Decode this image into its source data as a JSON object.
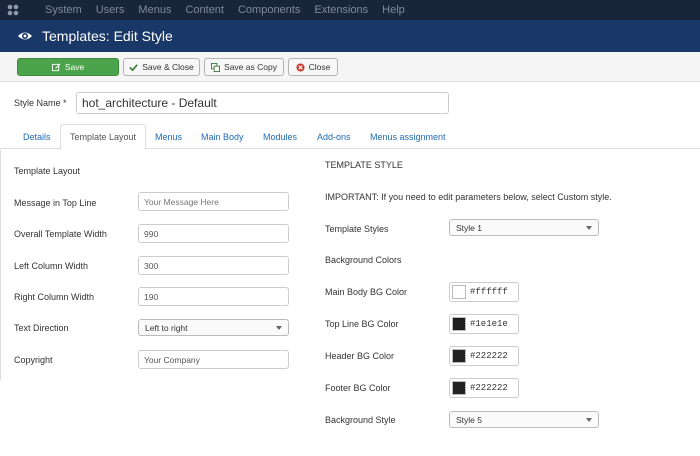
{
  "topnav": {
    "items": [
      "System",
      "Users",
      "Menus",
      "Content",
      "Components",
      "Extensions",
      "Help"
    ]
  },
  "header": {
    "title": "Templates: Edit Style"
  },
  "toolbar": {
    "save": "Save",
    "save_close": "Save & Close",
    "save_copy": "Save as Copy",
    "close": "Close"
  },
  "style_name": {
    "label": "Style Name *",
    "value": "hot_architecture - Default"
  },
  "tabs": [
    "Details",
    "Template Layout",
    "Menus",
    "Main Body",
    "Modules",
    "Add-ons",
    "Menus assignment"
  ],
  "layout": {
    "heading": "Template Layout",
    "message_label": "Message in Top Line",
    "message_placeholder": "Your Message Here",
    "width_label": "Overall Template Width",
    "width_value": "990",
    "left_label": "Left Column Width",
    "left_value": "300",
    "right_label": "Right Column Width",
    "right_value": "190",
    "direction_label": "Text Direction",
    "direction_value": "Left to right",
    "copyright_label": "Copyright",
    "copyright_value": "Your Company"
  },
  "style": {
    "heading": "TEMPLATE STYLE",
    "important": "IMPORTANT: If you need to edit parameters below, select Custom style.",
    "styles_label": "Template Styles",
    "styles_value": "Style 1",
    "bg_heading": "Background Colors",
    "main_label": "Main Body BG Color",
    "main_value": "#ffffff",
    "top_label": "Top Line BG Color",
    "top_value": "#1e1e1e",
    "header_label": "Header BG Color",
    "header_value": "#222222",
    "footer_label": "Footer BG Color",
    "footer_value": "#222222",
    "bgstyle_label": "Background Style",
    "bgstyle_value": "Style 5"
  },
  "colors": {
    "accent_green": "#4ba34b",
    "title_blue": "#1a3867",
    "topbar": "#18253b",
    "link": "#1f6bb6"
  }
}
